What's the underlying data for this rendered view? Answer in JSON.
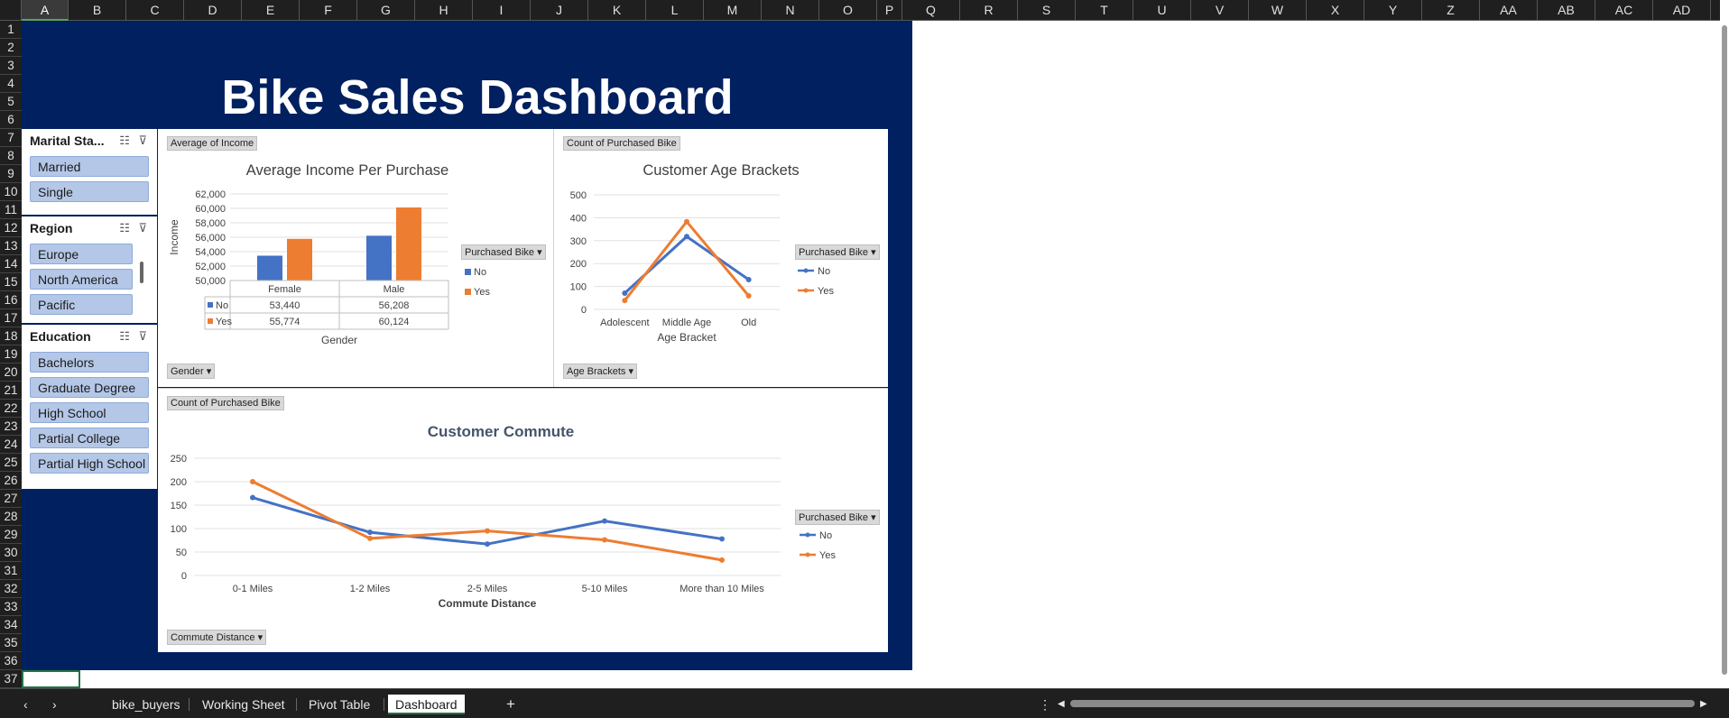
{
  "columns": [
    "A",
    "B",
    "C",
    "D",
    "E",
    "F",
    "G",
    "H",
    "I",
    "J",
    "K",
    "L",
    "M",
    "N",
    "O",
    "P",
    "Q",
    "R",
    "S",
    "T",
    "U",
    "V",
    "W",
    "X",
    "Y",
    "Z",
    "AA",
    "AB",
    "AC",
    "AD"
  ],
  "rows": [
    "1",
    "2",
    "3",
    "4",
    "5",
    "6",
    "7",
    "8",
    "9",
    "10",
    "11",
    "12",
    "13",
    "14",
    "15",
    "16",
    "17",
    "18",
    "19",
    "20",
    "21",
    "22",
    "23",
    "24",
    "25",
    "26",
    "27",
    "28",
    "29",
    "30",
    "31",
    "32",
    "33",
    "34",
    "35",
    "36",
    "37"
  ],
  "dashboard": {
    "title": "Bike Sales Dashboard"
  },
  "slicers": {
    "marital": {
      "label": "Marital Sta...",
      "items": [
        "Married",
        "Single"
      ]
    },
    "region": {
      "label": "Region",
      "items": [
        "Europe",
        "North America",
        "Pacific"
      ]
    },
    "education": {
      "label": "Education",
      "items": [
        "Bachelors",
        "Graduate Degree",
        "High School",
        "Partial College",
        "Partial High School"
      ]
    }
  },
  "charts": {
    "income": {
      "tag": "Average of Income",
      "field_button": "Gender",
      "legend_button": "Purchased Bike",
      "chart_data": {
        "type": "bar",
        "title": "Average Income Per Purchase",
        "ylabel": "Income",
        "xlabel": "Gender",
        "categories": [
          "Female",
          "Male"
        ],
        "series": [
          {
            "name": "No",
            "values": [
              53440,
              56208
            ],
            "labels": [
              "53,440",
              "56,208"
            ],
            "color": "#4472c4"
          },
          {
            "name": "Yes",
            "values": [
              55774,
              60124
            ],
            "labels": [
              "55,774",
              "60,124"
            ],
            "color": "#ed7d31"
          }
        ],
        "yticks": [
          "50,000",
          "52,000",
          "54,000",
          "56,000",
          "58,000",
          "60,000",
          "62,000"
        ],
        "ylim": [
          50000,
          62000
        ],
        "legend": "right",
        "data_table": true
      }
    },
    "age": {
      "tag": "Count of Purchased Bike",
      "field_button": "Age Brackets",
      "legend_button": "Purchased Bike",
      "chart_data": {
        "type": "line",
        "title": "Customer Age Brackets",
        "xlabel": "Age Bracket",
        "categories": [
          "Adolescent",
          "Middle Age",
          "Old"
        ],
        "series": [
          {
            "name": "No",
            "values": [
              71,
              318,
              130
            ],
            "color": "#4472c4"
          },
          {
            "name": "Yes",
            "values": [
              39,
              383,
              59
            ],
            "color": "#ed7d31"
          }
        ],
        "yticks": [
          "0",
          "100",
          "200",
          "300",
          "400",
          "500"
        ],
        "ylim": [
          0,
          500
        ],
        "legend": "right"
      }
    },
    "commute": {
      "tag": "Count of Purchased Bike",
      "field_button": "Commute Distance",
      "legend_button": "Purchased Bike",
      "chart_data": {
        "type": "line",
        "title": "Customer Commute",
        "xlabel": "Commute Distance",
        "categories": [
          "0-1 Miles",
          "1-2 Miles",
          "2-5 Miles",
          "5-10 Miles",
          "More than 10 Miles"
        ],
        "series": [
          {
            "name": "No",
            "values": [
              166,
              92,
              67,
              116,
              78
            ],
            "color": "#4472c4"
          },
          {
            "name": "Yes",
            "values": [
              200,
              79,
              95,
              76,
              33
            ],
            "color": "#ed7d31"
          }
        ],
        "yticks": [
          "0",
          "50",
          "100",
          "150",
          "200",
          "250"
        ],
        "ylim": [
          0,
          250
        ],
        "legend": "right"
      }
    }
  },
  "sheet_tabs": [
    "bike_buyers",
    "Working Sheet",
    "Pivot Table",
    "Dashboard"
  ],
  "active_tab": "Dashboard",
  "icons": {
    "prev": "‹",
    "next": "›",
    "add": "+",
    "more": "⋮",
    "scroll_left": "◀",
    "scroll_right": "▶"
  }
}
